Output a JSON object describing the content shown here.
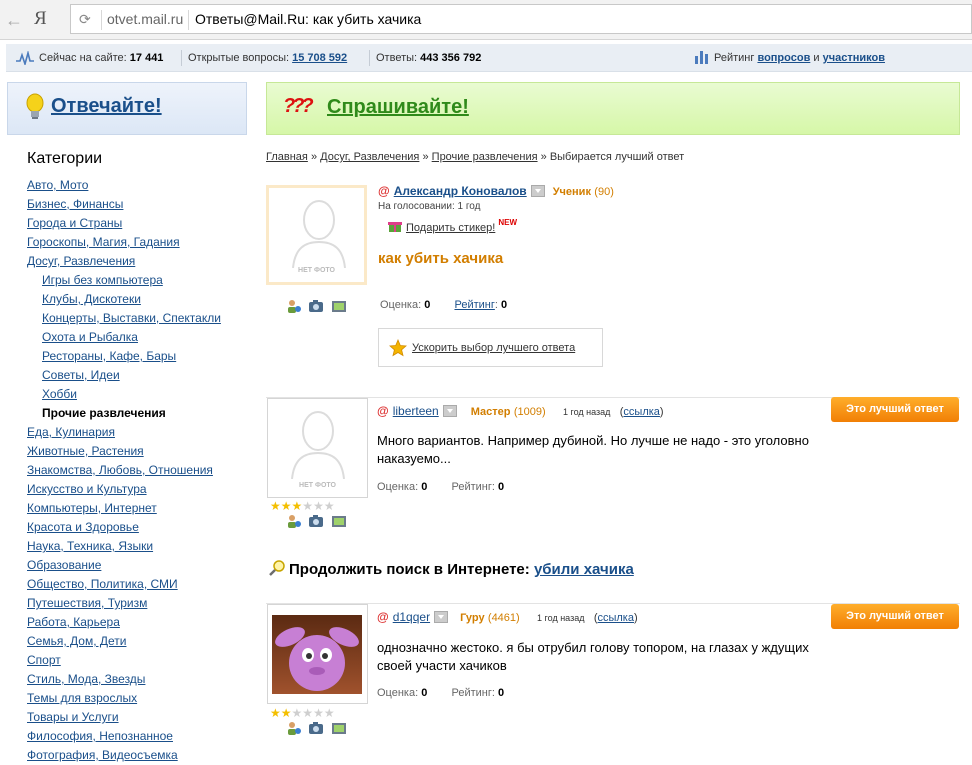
{
  "browser": {
    "logo": "Я",
    "host": "otvet.mail.ru",
    "title": "Ответы@Mail.Ru: как убить хачика"
  },
  "stats": {
    "online_label": "Сейчас на сайте:",
    "online_value": "17 441",
    "open_label": "Открытые вопросы:",
    "open_value": "15 708 592",
    "answers_label": "Ответы:",
    "answers_value": "443 356 792",
    "rating_label": "Рейтинг",
    "rating_questions": "вопросов",
    "rating_and": "и",
    "rating_participants": "участников"
  },
  "left_banner": {
    "title": "Отвечайте!"
  },
  "right_banner": {
    "icon_text": "???",
    "title": "Спрашивайте!"
  },
  "categories": {
    "heading": "Категории",
    "items": [
      "Авто, Мото",
      "Бизнес, Финансы",
      "Города и Страны",
      "Гороскопы, Магия, Гадания",
      "Досуг, Развлечения",
      "Игры без компьютера",
      "Клубы, Дискотеки",
      "Концерты, Выставки, Спектакли",
      "Охота и Рыбалка",
      "Рестораны, Кафе, Бары",
      "Советы, Идеи",
      "Хобби",
      "Прочие развлечения",
      "Еда, Кулинария",
      "Животные, Растения",
      "Знакомства, Любовь, Отношения",
      "Искусство и Культура",
      "Компьютеры, Интернет",
      "Красота и Здоровье",
      "Наука, Техника, Языки",
      "Образование",
      "Общество, Политика, СМИ",
      "Путешествия, Туризм",
      "Работа, Карьера",
      "Семья, Дом, Дети",
      "Спорт",
      "Стиль, Мода, Звезды",
      "Темы для взрослых",
      "Товары и Услуги",
      "Философия, Непознанное",
      "Фотография, Видеосъемка"
    ]
  },
  "breadcrumb": {
    "home": "Главная",
    "sep": "»",
    "section": "Досуг, Развлечения",
    "subsection": "Прочие развлечения",
    "current": "Выбирается лучший ответ"
  },
  "no_photo": "НЕТ ФОТО",
  "question": {
    "author": "Александр Коновалов",
    "rank": "Ученик",
    "points": "(90)",
    "voting": "На голосовании: 1 год",
    "gift": "Подарить стикер!",
    "new_badge": "NEW",
    "title": "как убить хачика",
    "score_label": "Оценка:",
    "score_value": "0",
    "rating_label": "Рейтинг",
    "rating_value": "0",
    "speed_link": "Ускорить выбор лучшего ответа"
  },
  "answers": [
    {
      "author": "liberteen",
      "rank": "Мастер",
      "points": "(1009)",
      "time": "1 год назад",
      "link_open": "(",
      "link_text": "ссылка",
      "link_close": ")",
      "best_button": "Это лучший ответ",
      "text": "Много вариантов. Например дубиной. Но лучше не надо - это уголовно наказуемо...",
      "score_label": "Оценка:",
      "score_value": "0",
      "rating_label": "Рейтинг:",
      "rating_value": "0",
      "stars": 3
    },
    {
      "author": "d1qqer",
      "rank": "Гуру",
      "points": "(4461)",
      "time": "1 год назад",
      "link_open": "(",
      "link_text": "ссылка",
      "link_close": ")",
      "best_button": "Это лучший ответ",
      "text": "однозначно жестоко. я бы отрубил голову топором, на глазах у ждущих своей участи хачиков",
      "score_label": "Оценка:",
      "score_value": "0",
      "rating_label": "Рейтинг:",
      "rating_value": "0",
      "stars": 2
    }
  ],
  "continue_search": {
    "label": "Продолжить поиск в Интернете:",
    "query": "убили хачика"
  },
  "colors": {
    "link": "#1a4f8a",
    "rank": "#d27e00",
    "best_button": "#f17f05",
    "green_title": "#2f8a1a"
  }
}
